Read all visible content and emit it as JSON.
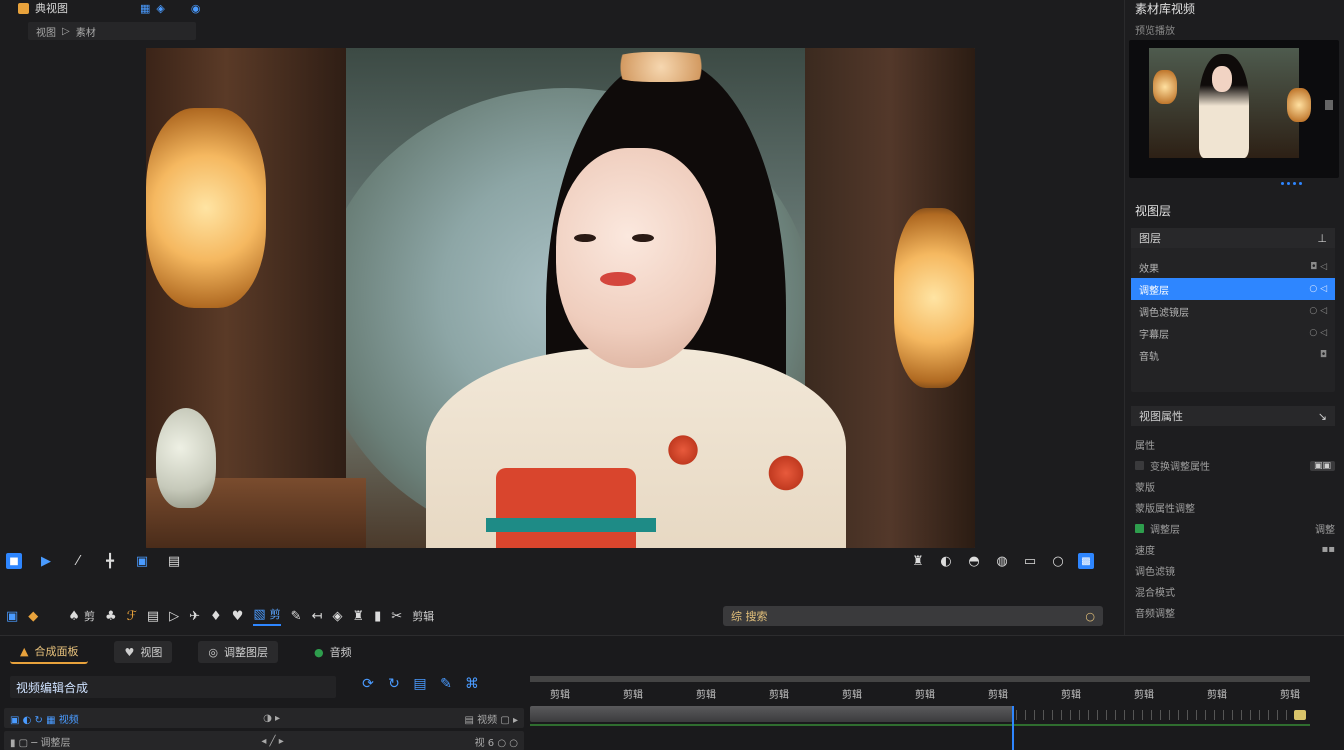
{
  "topbar": {
    "title": "典视图",
    "icon_a": "▦",
    "icon_b": "◈",
    "icon_c": "◉"
  },
  "breadcrumb": {
    "first": "视图",
    "sep": "▷",
    "second": "素材"
  },
  "preview_toolbar_left": [
    "■",
    "▶",
    "⁄",
    "╋",
    "▣",
    "▤"
  ],
  "preview_toolbar_right": [
    "♜",
    "◐",
    "◓",
    "◍",
    "▭",
    "○",
    "▩"
  ],
  "main_toolbar": {
    "items": [
      {
        "glyph": "▣",
        "label": ""
      },
      {
        "glyph": "◆",
        "label": ""
      },
      {
        "glyph": "♠",
        "label": "剪"
      },
      {
        "glyph": "♣",
        "label": ""
      },
      {
        "glyph": "ℱ",
        "label": ""
      },
      {
        "glyph": "▤",
        "label": ""
      },
      {
        "glyph": "▷",
        "label": ""
      },
      {
        "glyph": "✈",
        "label": ""
      },
      {
        "glyph": "♦",
        "label": ""
      },
      {
        "glyph": "♥",
        "label": ""
      },
      {
        "glyph": "▧",
        "label": "剪"
      },
      {
        "glyph": "✎",
        "label": ""
      },
      {
        "glyph": "↤",
        "label": ""
      },
      {
        "glyph": "◈",
        "label": ""
      },
      {
        "glyph": "♜",
        "label": ""
      },
      {
        "glyph": "▮",
        "label": ""
      },
      {
        "glyph": "✂",
        "label": ""
      },
      {
        "glyph": "",
        "label": "剪辑"
      }
    ],
    "search_label": "综 搜索",
    "search_icon": "○"
  },
  "right_panel": {
    "title": "素材库视频",
    "subtitle": "预览播放",
    "dots_count": 4,
    "section1_title": "视图层",
    "box1_head": "图层",
    "box1_head_icon": "⊥",
    "layers": [
      {
        "label": "效果",
        "icon": "◘ ◁"
      },
      {
        "label": "调整层",
        "icon": "○ ◁",
        "selected": true
      },
      {
        "label": "调色滤镜层",
        "icon": "○ ◁"
      },
      {
        "label": "字幕层",
        "icon": "○ ◁"
      },
      {
        "label": "音轨",
        "icon": "◘"
      }
    ],
    "section2_title": "视图属性",
    "section2_icon": "↘",
    "props_head": "属性",
    "props": [
      {
        "label": "变换调整属性",
        "value": "▣▣",
        "check": "off"
      },
      {
        "label": "蒙版",
        "value": "",
        "check": "none"
      },
      {
        "label": "蒙版属性调整",
        "value": "",
        "check": "none"
      },
      {
        "label": "调整层",
        "value": "调整",
        "check": "on"
      },
      {
        "label": "速度",
        "value": "▪▪",
        "check": "none"
      },
      {
        "label": "调色滤镜",
        "value": "",
        "check": "none"
      },
      {
        "label": "混合模式",
        "value": "",
        "check": "none"
      },
      {
        "label": "音频调整",
        "value": "",
        "check": "none"
      }
    ]
  },
  "bottom": {
    "tabs": [
      {
        "label": "合成面板",
        "icon": "▲",
        "active": true
      },
      {
        "label": "视图",
        "icon": "♥"
      },
      {
        "label": "调整图层",
        "icon": "◎"
      },
      {
        "label": "音频",
        "icon": "●"
      }
    ],
    "track_name": "视频编辑合成",
    "tl_tools": [
      "⟳",
      "↻",
      "▤",
      "✎",
      "⌘"
    ],
    "lanes": [
      {
        "left": "▣ ◐ ↻ ▦  视频",
        "mid": "◑ ▸",
        "right": "▤ 视频 ▢ ▸"
      },
      {
        "left": "▮ ▢ ─ 调整层",
        "mid": "◂ ╱ ▸",
        "right": "视 6  ○ ○"
      }
    ],
    "ruler_labels": [
      "剪辑",
      "剪辑",
      "剪辑",
      "剪辑",
      "剪辑",
      "剪辑",
      "剪辑",
      "剪辑",
      "剪辑",
      "剪辑",
      "剪辑"
    ]
  }
}
